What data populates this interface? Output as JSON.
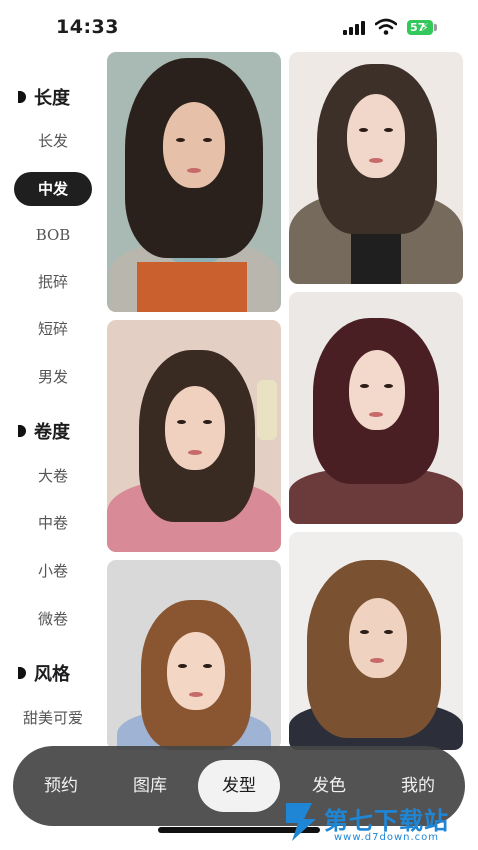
{
  "status_bar": {
    "time": "14:33",
    "battery": "57"
  },
  "sidebar": {
    "groups": [
      {
        "title": "长度",
        "items": [
          "长发",
          "中发",
          "BOB",
          "抿碎",
          "短碎",
          "男发"
        ]
      },
      {
        "title": "卷度",
        "items": [
          "大卷",
          "中卷",
          "小卷",
          "微卷"
        ]
      },
      {
        "title": "风格",
        "items": [
          "甜美可爱"
        ]
      }
    ],
    "active_item": "中发"
  },
  "bottom_nav": {
    "items": [
      "预约",
      "图库",
      "发型",
      "发色",
      "我的"
    ],
    "active": "发型"
  },
  "watermark": {
    "title": "第七下载站",
    "url": "www.d7down.com"
  },
  "colors": {
    "active_pill": "#1f1f1f",
    "nav_bg": "#464646",
    "battery": "#34c759",
    "watermark": "#1f86d6"
  }
}
